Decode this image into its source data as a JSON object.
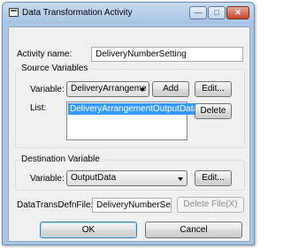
{
  "window": {
    "title": "Data Transformation Activity",
    "min_glyph": "—",
    "max_glyph": "□",
    "close_glyph": "✕"
  },
  "activity_name": {
    "label": "Activity name:",
    "value": "DeliveryNumberSetting"
  },
  "source_variables": {
    "group_title": "Source Variables",
    "variable_label": "Variable:",
    "variable_selected": "DeliveryArrangeme",
    "add_label": "Add",
    "edit_label": "Edit...",
    "list_label": "List:",
    "list_items": [
      "DeliveryArrangementOutputData"
    ],
    "delete_label": "Delete"
  },
  "destination_variable": {
    "group_title": "Destination Variable",
    "variable_label": "Variable:",
    "variable_selected": "OutputData",
    "edit_label": "Edit..."
  },
  "data_trans_defn_file": {
    "label": "DataTransDefnFile:",
    "value": "DeliveryNumberSetti",
    "delete_file_label": "Delete File(X)"
  },
  "footer": {
    "ok_label": "OK",
    "cancel_label": "Cancel"
  }
}
